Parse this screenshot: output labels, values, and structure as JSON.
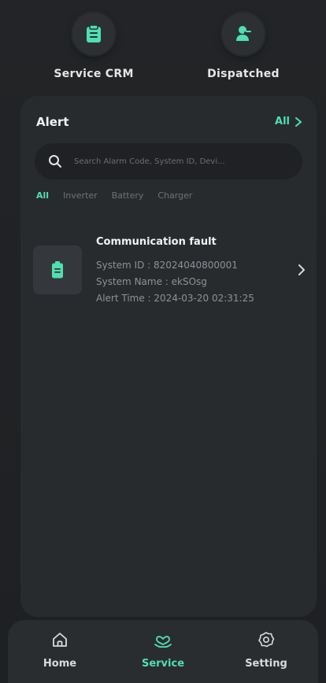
{
  "quick_actions": {
    "service_crm": {
      "label": "Service CRM",
      "icon": "clipboard-icon"
    },
    "dispatched": {
      "label": "Dispatched",
      "icon": "technician-icon"
    }
  },
  "alert": {
    "title": "Alert",
    "all_label": "All",
    "search_placeholder": "Search Alarm Code, System ID, Devi...",
    "filters": [
      "All",
      "Inverter",
      "Battery",
      "Charger"
    ],
    "active_filter": "All",
    "items": [
      {
        "fault": "Communication fault",
        "system_id": "System ID : 82024040800001",
        "system_name": "System Name : ekSOsg",
        "alert_time": "Alert Time : 2024-03-20 02:31:25",
        "icon": "battery-icon"
      }
    ]
  },
  "nav": {
    "home": "Home",
    "service": "Service",
    "setting": "Setting",
    "active": "Service"
  },
  "colors": {
    "accent": "#4fe0b0",
    "background": "#1f2124",
    "card": "#282b2e"
  }
}
